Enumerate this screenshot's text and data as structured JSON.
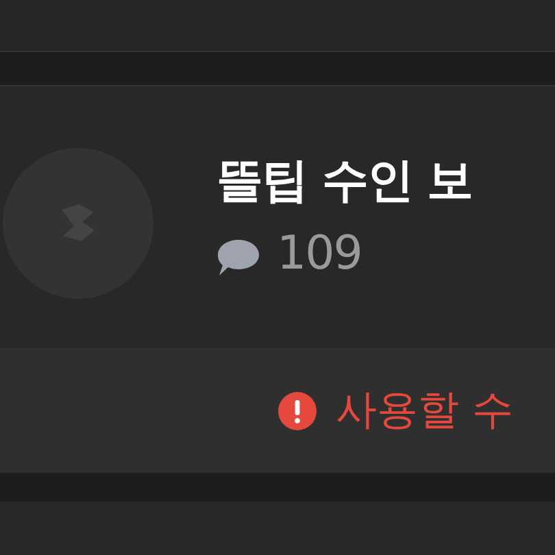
{
  "post": {
    "title": "뜰팁 수인 보",
    "comment_count": "109"
  },
  "notice": {
    "kind": "error",
    "text": "사용할 수"
  }
}
